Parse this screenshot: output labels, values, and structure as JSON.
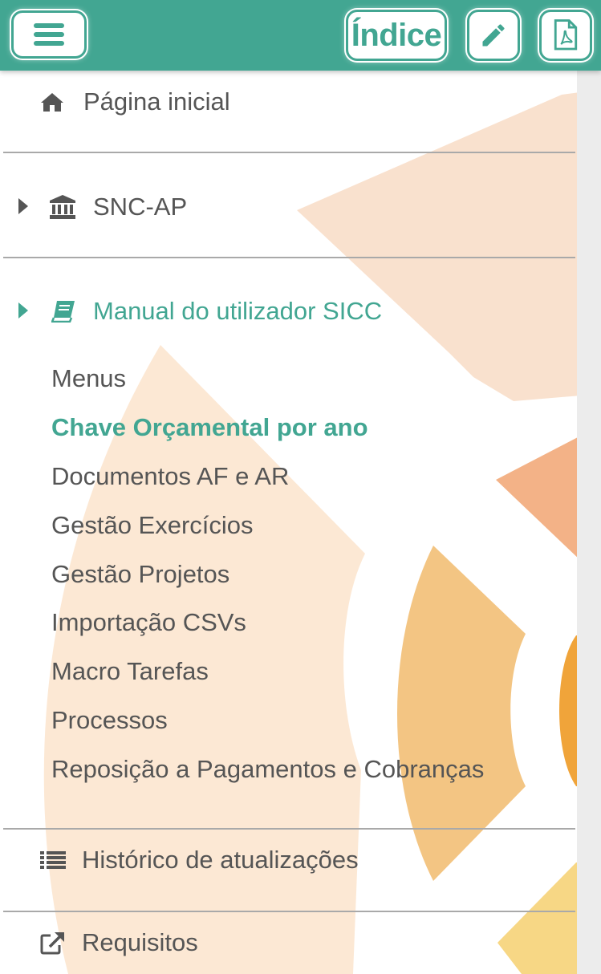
{
  "header": {
    "index_label": "Índice",
    "accent_color": "#42a692",
    "icons": [
      "hamburger-menu-icon",
      "pencil-icon",
      "pdf-file-icon"
    ]
  },
  "menu": {
    "home": {
      "label": "Página inicial",
      "icon": "home-icon"
    },
    "snc": {
      "label": "SNC-AP",
      "icon": "bank-icon"
    },
    "manual": {
      "label": "Manual do utilizador SICC",
      "icon": "book-icon",
      "subitems": [
        "Menus",
        "Chave Orçamental por ano",
        "Documentos AF e AR",
        "Gestão Exercícios",
        "Gestão Projetos",
        "Importação CSVs",
        "Macro Tarefas",
        "Processos",
        "Reposição a Pagamentos e Cobranças"
      ],
      "active_subitem": "Chave Orçamental por ano"
    },
    "history": {
      "label": "Histórico de atualizações",
      "icon": "list-icon"
    },
    "requirements": {
      "label": "Requisitos",
      "icon": "external-link-icon"
    }
  }
}
